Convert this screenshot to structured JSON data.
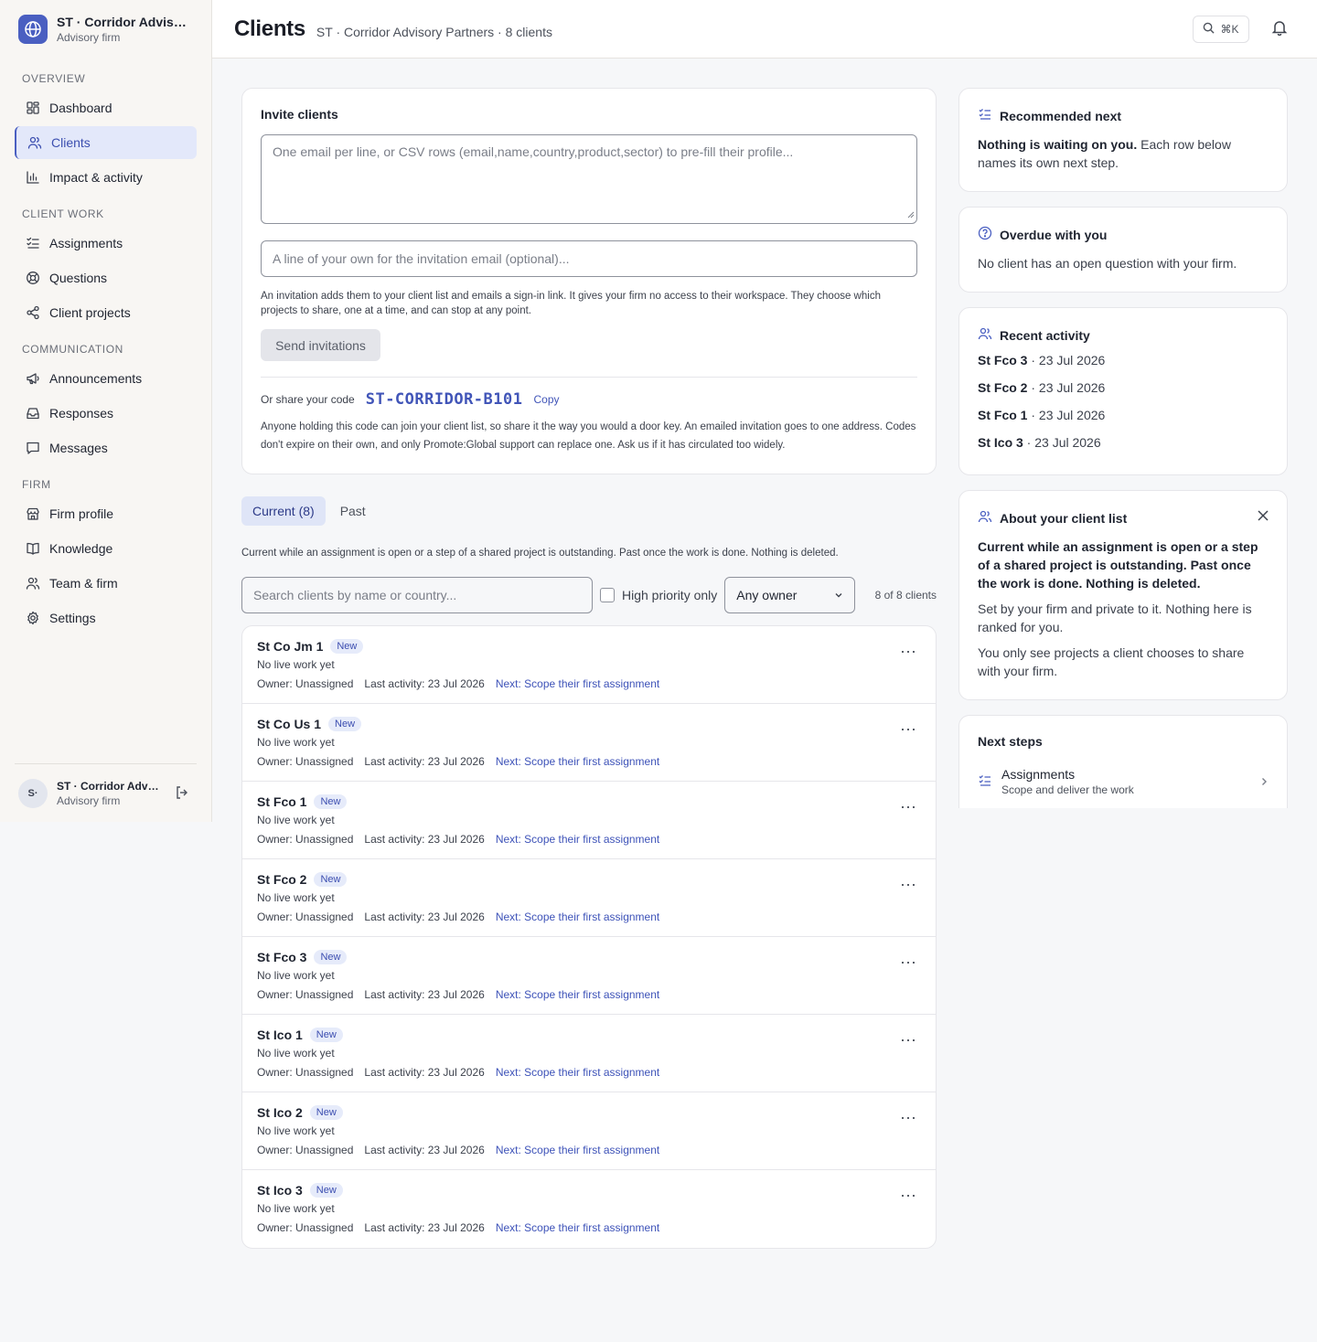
{
  "brand": {
    "name": "ST · Corridor Advisory...",
    "subtitle": "Advisory firm",
    "avatar_initials": "S·"
  },
  "nav": [
    {
      "section": "OVERVIEW",
      "items": [
        {
          "label": "Dashboard",
          "icon": "dashboard-icon",
          "active": false
        },
        {
          "label": "Clients",
          "icon": "users-icon",
          "active": true
        },
        {
          "label": "Impact & activity",
          "icon": "chart-icon",
          "active": false
        }
      ]
    },
    {
      "section": "CLIENT WORK",
      "items": [
        {
          "label": "Assignments",
          "icon": "checklist-icon",
          "active": false
        },
        {
          "label": "Questions",
          "icon": "lifebuoy-icon",
          "active": false
        },
        {
          "label": "Client projects",
          "icon": "share-icon",
          "active": false
        }
      ]
    },
    {
      "section": "COMMUNICATION",
      "items": [
        {
          "label": "Announcements",
          "icon": "megaphone-icon",
          "active": false
        },
        {
          "label": "Responses",
          "icon": "inbox-icon",
          "active": false
        },
        {
          "label": "Messages",
          "icon": "message-icon",
          "active": false
        }
      ]
    },
    {
      "section": "FIRM",
      "items": [
        {
          "label": "Firm profile",
          "icon": "store-icon",
          "active": false
        },
        {
          "label": "Knowledge",
          "icon": "book-icon",
          "active": false
        },
        {
          "label": "Team & firm",
          "icon": "team-icon",
          "active": false
        },
        {
          "label": "Settings",
          "icon": "gear-icon",
          "active": false
        }
      ]
    }
  ],
  "footer": {
    "name": "ST · Corridor Advis...",
    "subtitle": "Advisory firm",
    "avatar": "S·"
  },
  "header": {
    "title": "Clients",
    "subtitle": "ST · Corridor Advisory Partners · 8 clients",
    "search_shortcut": "⌘K"
  },
  "invite": {
    "title": "Invite clients",
    "emails_placeholder": "One email per line, or CSV rows (email,name,country,product,sector) to pre-fill their profile...",
    "note_placeholder": "A line of your own for the invitation email (optional)...",
    "hint": "An invitation adds them to your client list and emails a sign-in link. It gives your firm no access to their workspace. They choose which projects to share, one at a time, and can stop at any point.",
    "send_label": "Send invitations",
    "code_label": "Or share your code",
    "code_value": "ST-CORRIDOR-B101",
    "copy_label": "Copy",
    "code_note": "Anyone holding this code can join your client list, so share it the way you would a door key. An emailed invitation goes to one address. Codes don't expire on their own, and only Promote:Global support can replace one. Ask us if it has circulated too widely."
  },
  "tabs": {
    "current": "Current (8)",
    "past": "Past",
    "note": "Current while an assignment is open or a step of a shared project is outstanding. Past once the work is done. Nothing is deleted."
  },
  "filters": {
    "search_placeholder": "Search clients by name or country...",
    "high_priority": "High priority only",
    "owner": "Any owner",
    "count": "8 of 8 clients"
  },
  "clients": [
    {
      "name": "St Co Jm 1",
      "badge": "New",
      "status": "No live work yet",
      "owner": "Owner: Unassigned",
      "last": "Last activity: 23 Jul 2026",
      "next": "Next: Scope their first assignment"
    },
    {
      "name": "St Co Us 1",
      "badge": "New",
      "status": "No live work yet",
      "owner": "Owner: Unassigned",
      "last": "Last activity: 23 Jul 2026",
      "next": "Next: Scope their first assignment"
    },
    {
      "name": "St Fco 1",
      "badge": "New",
      "status": "No live work yet",
      "owner": "Owner: Unassigned",
      "last": "Last activity: 23 Jul 2026",
      "next": "Next: Scope their first assignment"
    },
    {
      "name": "St Fco 2",
      "badge": "New",
      "status": "No live work yet",
      "owner": "Owner: Unassigned",
      "last": "Last activity: 23 Jul 2026",
      "next": "Next: Scope their first assignment"
    },
    {
      "name": "St Fco 3",
      "badge": "New",
      "status": "No live work yet",
      "owner": "Owner: Unassigned",
      "last": "Last activity: 23 Jul 2026",
      "next": "Next: Scope their first assignment"
    },
    {
      "name": "St Ico 1",
      "badge": "New",
      "status": "No live work yet",
      "owner": "Owner: Unassigned",
      "last": "Last activity: 23 Jul 2026",
      "next": "Next: Scope their first assignment"
    },
    {
      "name": "St Ico 2",
      "badge": "New",
      "status": "No live work yet",
      "owner": "Owner: Unassigned",
      "last": "Last activity: 23 Jul 2026",
      "next": "Next: Scope their first assignment"
    },
    {
      "name": "St Ico 3",
      "badge": "New",
      "status": "No live work yet",
      "owner": "Owner: Unassigned",
      "last": "Last activity: 23 Jul 2026",
      "next": "Next: Scope their first assignment"
    }
  ],
  "recommended": {
    "title": "Recommended next",
    "bold": "Nothing is waiting on you.",
    "text": " Each row below names its own next step."
  },
  "overdue": {
    "title": "Overdue with you",
    "text": "No client has an open question with your firm."
  },
  "activity": {
    "title": "Recent activity",
    "items": [
      {
        "name": "St Fco 3",
        "date": " · 23 Jul 2026"
      },
      {
        "name": "St Fco 2",
        "date": " · 23 Jul 2026"
      },
      {
        "name": "St Fco 1",
        "date": " · 23 Jul 2026"
      },
      {
        "name": "St Ico 3",
        "date": " · 23 Jul 2026"
      }
    ]
  },
  "about": {
    "title": "About your client list",
    "bold": "Current while an assignment is open or a step of a shared project is outstanding. Past once the work is done. Nothing is deleted.",
    "p1": "Set by your firm and private to it. Nothing here is ranked for you.",
    "p2": "You only see projects a client chooses to share with your firm."
  },
  "next_steps": {
    "title": "Next steps",
    "item_label": "Assignments",
    "item_sub": "Scope and deliver the work"
  },
  "colors": {
    "accent": "#4a5fc1",
    "active_bg": "#e3e8fa",
    "sidebar_bg": "#f8f6f3"
  }
}
